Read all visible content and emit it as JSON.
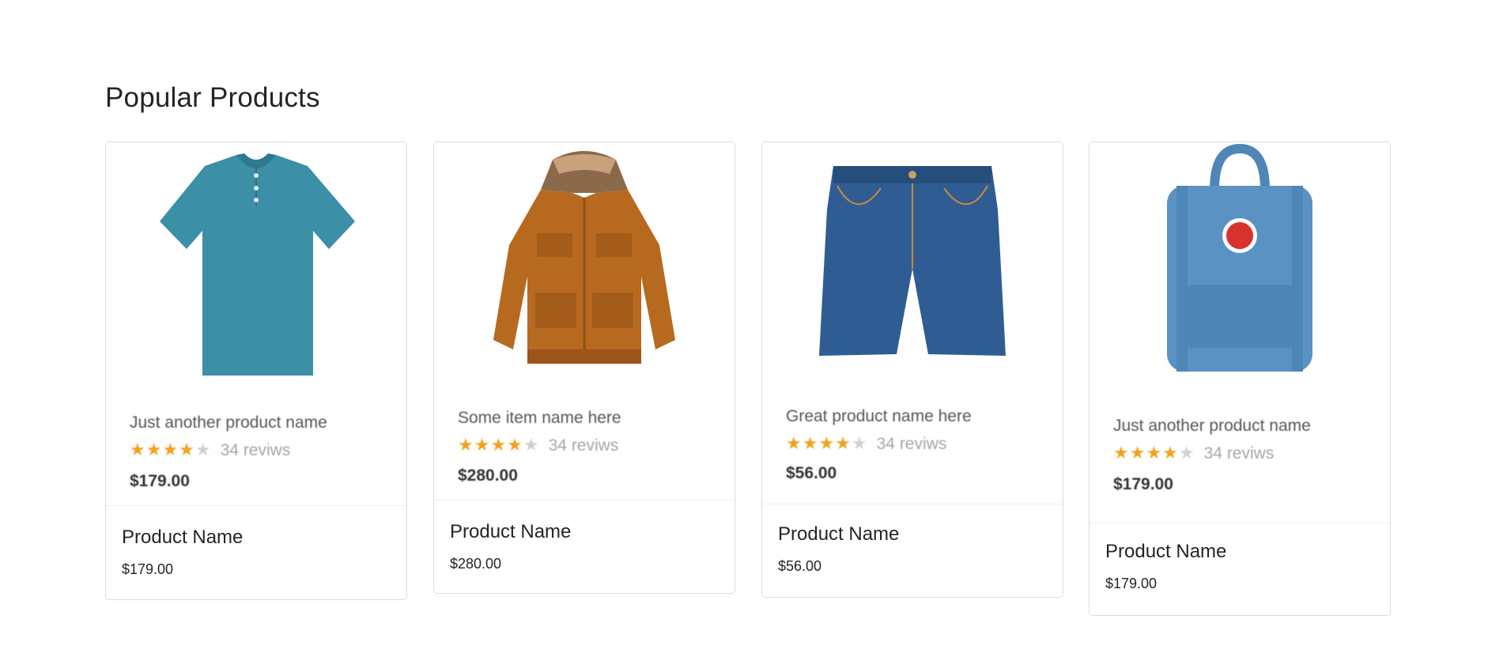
{
  "section": {
    "title": "Popular Products"
  },
  "products": [
    {
      "image_name": "Just another product name",
      "image_rating": 4,
      "image_reviews": "34 reviws",
      "image_price": "$179.00",
      "title": "Product Name",
      "price": "$179.00",
      "image_subject": "polo-shirt",
      "colors": {
        "item": "#3b8fa6"
      }
    },
    {
      "image_name": "Some item name here",
      "image_rating": 4,
      "image_reviews": "34 reviws",
      "image_price": "$280.00",
      "title": "Product Name",
      "price": "$280.00",
      "image_subject": "parka-jacket",
      "colors": {
        "item": "#b7691f"
      }
    },
    {
      "image_name": "Great product name here",
      "image_rating": 4,
      "image_reviews": "34 reviws",
      "image_price": "$56.00",
      "title": "Product Name",
      "price": "$56.00",
      "image_subject": "denim-shorts",
      "colors": {
        "item": "#2f5d93"
      }
    },
    {
      "image_name": "Just another product name",
      "image_rating": 4,
      "image_reviews": "34 reviws",
      "image_price": "$179.00",
      "title": "Product Name",
      "price": "$179.00",
      "image_subject": "backpack",
      "colors": {
        "item": "#5a92c4"
      }
    }
  ],
  "colors": {
    "star": "#f2a21b",
    "star_empty": "#d0d0d0",
    "border": "#dcdcdc"
  }
}
